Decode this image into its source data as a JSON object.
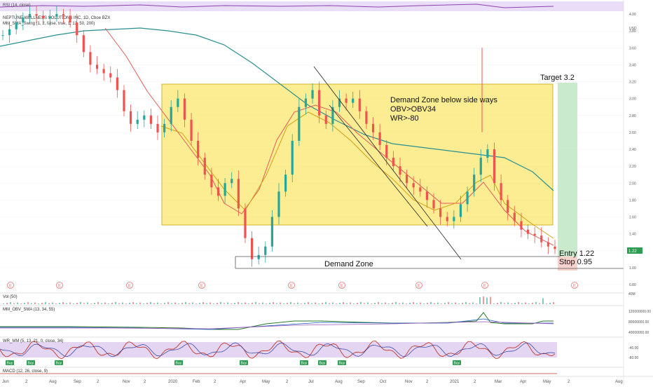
{
  "chart_data": {
    "type": "candlestick",
    "header": {
      "rsi_label": "RSI (14, close)",
      "symbol_label": "NEPTUNE WELLNESS SOLUTIONS INC, 1D, Cboe BZX",
      "sma_label": "MM_SMA_Swing (1, 2, false, true, 1, 13, 50, 200)"
    },
    "price_axis": {
      "currency": "USD",
      "ylim": [
        0.8,
        4.0
      ],
      "ticks": [
        "4.00",
        "3.80",
        "3.60",
        "3.40",
        "3.20",
        "3.00",
        "2.80",
        "2.60",
        "2.40",
        "2.20",
        "2.00",
        "1.80",
        "1.60",
        "1.40",
        "1.20",
        "1.00",
        "0.80"
      ],
      "current_price_label": "1.22"
    },
    "time_axis": {
      "ticks": [
        "Jun",
        "2",
        "Aug",
        "Sep",
        "2",
        "Nov",
        "2",
        "2020",
        "Feb",
        "2",
        "Apr",
        "May",
        "2",
        "Jul",
        "Aug",
        "Sep",
        "Oct",
        "Nov",
        "2",
        "2021",
        "2",
        "Mar",
        "Apr",
        "May",
        "2",
        "Aug"
      ]
    },
    "annotations": {
      "zone_text_line1": "Demand Zone below side ways",
      "zone_text_line2": "OBV>OBV34",
      "zone_text_line3": "WR>-80",
      "target_label": "Target 3.2",
      "entry_label": "Entry 1.22",
      "stop_label": "Stop 0.95",
      "demand_zone_label": "Demand Zone",
      "zone_top_price": 3.18,
      "zone_bottom_price": 1.5,
      "target_price": 3.2,
      "entry_price": 1.22,
      "stop_price": 0.95,
      "demand_line_price": 1.13
    },
    "event_marker_label": "E",
    "vol_label": "Vol (50)",
    "obv_label": "MM_OBV_SMA (13, 34, 55)",
    "obv_ticks": [
      "120000000.00",
      "80000000.00",
      "40000000.00"
    ],
    "wr_label": "WR_MM (5, 13, 21, 0, close, 34)",
    "wr_ticks": [
      "-40.00",
      "-80.00"
    ],
    "buy_label": "Buy",
    "macd_label": "MACD (12, 26, close, 9)",
    "vol_tick": "40M",
    "series": {
      "close": [
        3.75,
        3.82,
        3.9,
        3.96,
        4.0,
        3.98,
        3.95,
        3.97,
        4.0,
        3.98,
        3.9,
        3.75,
        3.55,
        3.4,
        3.35,
        3.3,
        3.25,
        3.1,
        2.85,
        2.7,
        2.75,
        2.8,
        2.7,
        2.6,
        2.7,
        2.9,
        3.0,
        2.75,
        2.5,
        2.3,
        2.1,
        1.95,
        1.85,
        2.0,
        2.05,
        1.7,
        1.35,
        1.1,
        1.15,
        1.25,
        1.6,
        1.9,
        2.1,
        2.5,
        2.9,
        3.0,
        3.1,
        2.8,
        2.7,
        2.9,
        3.0,
        2.95,
        3.0,
        2.85,
        2.7,
        2.6,
        2.45,
        2.3,
        2.2,
        2.1,
        2.0,
        1.95,
        1.9,
        1.8,
        1.7,
        1.6,
        1.55,
        1.6,
        1.75,
        1.9,
        2.1,
        2.3,
        2.4,
        2.0,
        1.8,
        1.65,
        1.55,
        1.45,
        1.4,
        1.38,
        1.3,
        1.25,
        1.22
      ]
    }
  }
}
